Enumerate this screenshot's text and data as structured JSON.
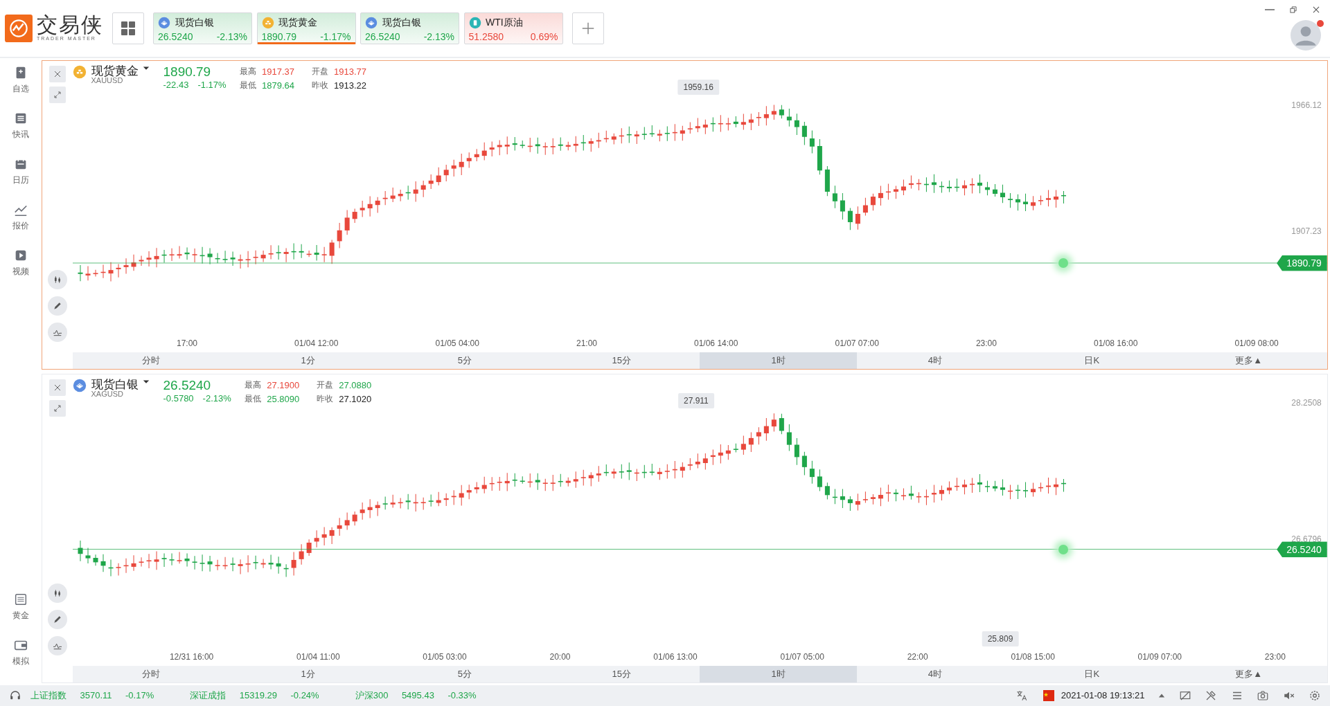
{
  "app": {
    "name": "交易侠",
    "tagline": "TRADER MASTER"
  },
  "quote_tabs": [
    {
      "name": "现货白银",
      "kind": "silver",
      "price": "26.5240",
      "change": "-2.13%",
      "color": "#1fa64a",
      "selected": false
    },
    {
      "name": "现货黄金",
      "kind": "gold",
      "price": "1890.79",
      "change": "-1.17%",
      "color": "#1fa64a",
      "selected": true
    },
    {
      "name": "现货白银",
      "kind": "silver",
      "price": "26.5240",
      "change": "-2.13%",
      "color": "#1fa64a",
      "selected": false
    },
    {
      "name": "WTI原油",
      "kind": "oil",
      "price": "51.2580",
      "change": "0.69%",
      "color": "#e8483c",
      "selected": false
    }
  ],
  "user": {
    "notification": true
  },
  "sidebar": {
    "top": [
      {
        "label": "自选",
        "kind": "bookmark"
      },
      {
        "label": "快讯",
        "kind": "news"
      },
      {
        "label": "日历",
        "kind": "calendar"
      },
      {
        "label": "报价",
        "kind": "quotes"
      },
      {
        "label": "视频",
        "kind": "video"
      }
    ],
    "bottom": [
      {
        "label": "黄金",
        "kind": "exchange"
      },
      {
        "label": "模拟",
        "kind": "wallet"
      }
    ]
  },
  "panels": [
    {
      "name": "现货黄金",
      "symbol": "XAUUSD",
      "kind": "gold",
      "selected": true,
      "price": "1890.79",
      "change": "-22.43",
      "change_pct": "-1.17%",
      "stats": [
        {
          "label": "最高",
          "value": "1917.37",
          "color": "#e8483c"
        },
        {
          "label": "开盘",
          "value": "1913.77",
          "color": "#e8483c"
        },
        {
          "label": "最低",
          "value": "1879.64",
          "color": "#1fa64a"
        },
        {
          "label": "昨收",
          "value": "1913.22",
          "color": "#222222"
        }
      ],
      "y_labels": [
        "1966.12",
        "1907.23"
      ],
      "last_price": "1890.79",
      "high_label": "1959.16",
      "x_labels": [
        "17:00",
        "01/04 12:00",
        "01/05 04:00",
        "21:00",
        "01/06 14:00",
        "01/07 07:00",
        "23:00",
        "01/08 16:00",
        "01/09 08:00"
      ],
      "intervals": [
        {
          "label": "分时",
          "selected": false
        },
        {
          "label": "1分",
          "selected": false
        },
        {
          "label": "5分",
          "selected": false
        },
        {
          "label": "15分",
          "selected": false
        },
        {
          "label": "1时",
          "selected": true
        },
        {
          "label": "4时",
          "selected": false
        },
        {
          "label": "日K",
          "selected": false
        },
        {
          "label": "更多▲",
          "selected": false
        }
      ]
    },
    {
      "name": "现货白银",
      "symbol": "XAGUSD",
      "kind": "silver",
      "selected": false,
      "price": "26.5240",
      "change": "-0.5780",
      "change_pct": "-2.13%",
      "stats": [
        {
          "label": "最高",
          "value": "27.1900",
          "color": "#e8483c"
        },
        {
          "label": "开盘",
          "value": "27.0880",
          "color": "#1fa64a"
        },
        {
          "label": "最低",
          "value": "25.8090",
          "color": "#1fa64a"
        },
        {
          "label": "昨收",
          "value": "27.1020",
          "color": "#222222"
        }
      ],
      "y_labels": [
        "28.2508",
        "26.6796"
      ],
      "last_price": "26.5240",
      "high_label": "27.911",
      "low_label": "25.809",
      "x_labels": [
        "12/31 16:00",
        "01/04 11:00",
        "01/05 03:00",
        "20:00",
        "01/06 13:00",
        "01/07 05:00",
        "22:00",
        "01/08 15:00",
        "01/09 07:00",
        "23:00"
      ],
      "intervals": [
        {
          "label": "分时",
          "selected": false
        },
        {
          "label": "1分",
          "selected": false
        },
        {
          "label": "5分",
          "selected": false
        },
        {
          "label": "15分",
          "selected": false
        },
        {
          "label": "1时",
          "selected": true
        },
        {
          "label": "4时",
          "selected": false
        },
        {
          "label": "日K",
          "selected": false
        },
        {
          "label": "更多▲",
          "selected": false
        }
      ]
    }
  ],
  "status_bar": {
    "indices": [
      {
        "name": "上证指数",
        "value": "3570.11",
        "change": "-0.17%",
        "color": "#1fa64a"
      },
      {
        "name": "深证成指",
        "value": "15319.29",
        "change": "-0.24%",
        "color": "#1fa64a"
      },
      {
        "name": "沪深300",
        "value": "5495.43",
        "change": "-0.33%",
        "color": "#1fa64a"
      }
    ],
    "datetime": "2021-01-08 19:13:21"
  }
}
